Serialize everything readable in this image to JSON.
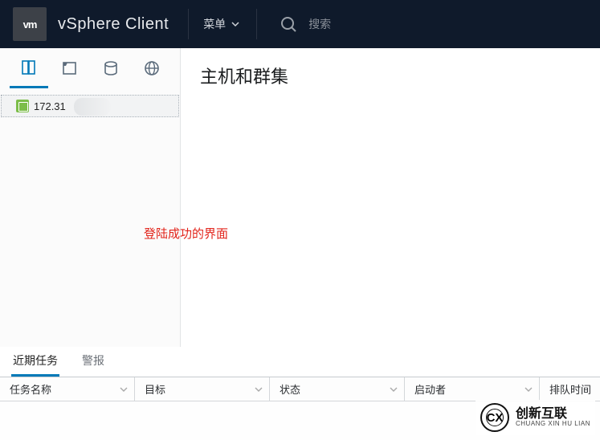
{
  "topbar": {
    "logo_text": "vm",
    "brand": "vSphere Client",
    "menu_label": "菜单",
    "search_placeholder": "搜索"
  },
  "sidebar": {
    "tree_items": [
      {
        "label": "172.31"
      }
    ]
  },
  "content": {
    "page_title": "主机和群集",
    "annotation": "登陆成功的界面"
  },
  "bottom_tabs": {
    "recent_tasks": "近期任务",
    "alarms": "警报"
  },
  "grid_columns": {
    "c1": "任务名称",
    "c2": "目标",
    "c3": "状态",
    "c4": "启动者",
    "c5": "排队时间"
  },
  "watermark": {
    "logo": "CX",
    "cn": "创新互联",
    "en": "CHUANG XIN HU LIAN"
  }
}
